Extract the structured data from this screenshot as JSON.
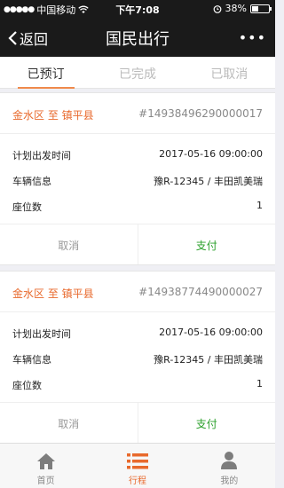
{
  "status_bar": {
    "signal_dots": "●●●●●",
    "carrier": "中国移动",
    "wifi_icon": "wifi-icon",
    "time": "下午7:08",
    "alarm_icon": "alarm-icon",
    "battery_percent": "38%",
    "battery_level": 0.38
  },
  "nav": {
    "back_label": "返回",
    "title": "国民出行",
    "more_label": "•••"
  },
  "tabs": [
    {
      "label": "已预订",
      "active": true
    },
    {
      "label": "已完成",
      "active": false
    },
    {
      "label": "已取消",
      "active": false
    }
  ],
  "orders": [
    {
      "route": "金水区 至 镇平县",
      "order_no": "#14938496290000017",
      "fields": [
        {
          "label": "计划出发时间",
          "value": "2017-05-16 09:00:00"
        },
        {
          "label": "车辆信息",
          "value": "豫R-12345 / 丰田凯美瑞"
        },
        {
          "label": "座位数",
          "value": "1"
        }
      ],
      "cancel_label": "取消",
      "pay_label": "支付"
    },
    {
      "route": "金水区 至 镇平县",
      "order_no": "#14938774490000027",
      "fields": [
        {
          "label": "计划出发时间",
          "value": "2017-05-16 09:00:00"
        },
        {
          "label": "车辆信息",
          "value": "豫R-12345 / 丰田凯美瑞"
        },
        {
          "label": "座位数",
          "value": "1"
        }
      ],
      "cancel_label": "取消",
      "pay_label": "支付"
    }
  ],
  "tabbar": [
    {
      "label": "首页",
      "icon": "home-icon",
      "active": false
    },
    {
      "label": "行程",
      "icon": "list-icon",
      "active": true
    },
    {
      "label": "我的",
      "icon": "person-icon",
      "active": false
    }
  ],
  "colors": {
    "accent": "#e8692c",
    "pay_green": "#2ba02b",
    "nav_bg": "#1a1a1a"
  }
}
